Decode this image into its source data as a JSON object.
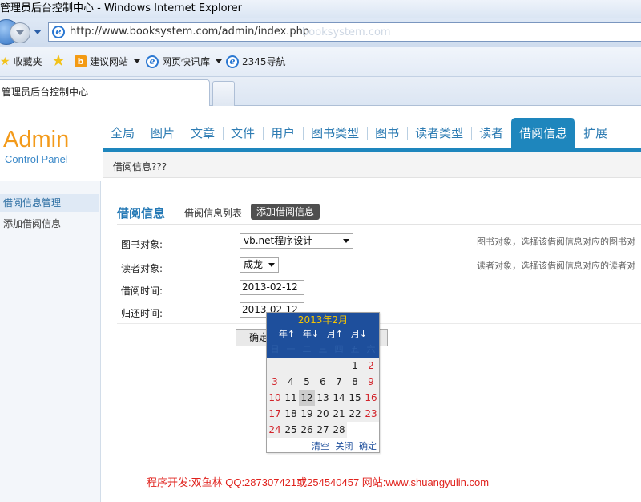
{
  "window": {
    "title": "管理员后台控制中心 - Windows Internet Explorer"
  },
  "address_bar": {
    "url": "http://www.booksystem.com/admin/index.php",
    "ghost_text": "booksystem.com"
  },
  "favorites_bar": {
    "favorites_label": "收藏夹",
    "items": [
      {
        "label": "建议网站",
        "icon": "bing-icon",
        "has_dropdown": true
      },
      {
        "label": "网页快讯库",
        "icon": "ie-icon",
        "has_dropdown": true
      },
      {
        "label": "2345导航",
        "icon": "ie-icon",
        "has_dropdown": false
      }
    ]
  },
  "tabs": {
    "active_label": "管理员后台控制中心"
  },
  "logo": {
    "title": "Admin",
    "subtitle": "Control Panel"
  },
  "nav": {
    "items": [
      "全局",
      "图片",
      "文章",
      "文件",
      "用户",
      "图书类型",
      "图书",
      "读者类型",
      "读者",
      "借阅信息",
      "扩展"
    ],
    "active": "借阅信息"
  },
  "subheader": {
    "text": "借阅信息???"
  },
  "sidebar": {
    "items": [
      "借阅信息管理",
      "添加借阅信息"
    ],
    "selected": "借阅信息管理"
  },
  "section": {
    "title": "借阅信息",
    "tab_list": "借阅信息列表",
    "tab_add": "添加借阅信息"
  },
  "form": {
    "book_label": "图书对象:",
    "book_value": "vb.net程序设计",
    "book_hint": "图书对象，选择该借阅信息对应的图书对",
    "reader_label": "读者对象:",
    "reader_value": "成龙",
    "reader_hint": "读者对象，选择该借阅信息对应的读者对",
    "borrow_label": "借阅时间:",
    "borrow_value": "2013-02-12",
    "return_label": "归还时间:",
    "return_value": "2013-02-12",
    "confirm_label": "确定"
  },
  "calendar": {
    "title": "2013年2月",
    "nav": [
      "年↑",
      "年↓",
      "月↑",
      "月↓"
    ],
    "weekdays": [
      "日",
      "一",
      "二",
      "三",
      "四",
      "五",
      "六"
    ],
    "leading_blanks": 5,
    "days": [
      "1",
      "2",
      "3",
      "4",
      "5",
      "6",
      "7",
      "8",
      "9",
      "10",
      "11",
      "12",
      "13",
      "14",
      "15",
      "16",
      "17",
      "18",
      "19",
      "20",
      "21",
      "22",
      "23",
      "24",
      "25",
      "26",
      "27",
      "28"
    ],
    "selected_day": "12",
    "footer": [
      "清空",
      "关闭",
      "确定"
    ],
    "header_color": "#1e4f9c",
    "title_color": "#f5c400",
    "weekend_color": "#d2242b"
  },
  "footer": {
    "credit": "程序开发:双鱼林 QQ:287307421或254540457 网站:www.shuangyulin.com"
  }
}
